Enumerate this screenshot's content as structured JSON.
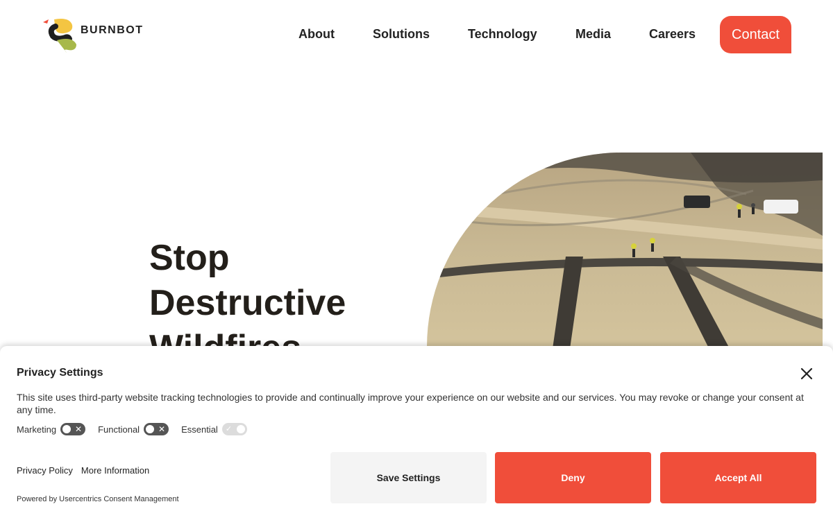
{
  "header": {
    "brand": "BURNBOT",
    "nav": [
      {
        "label": "About"
      },
      {
        "label": "Solutions"
      },
      {
        "label": "Technology"
      },
      {
        "label": "Media"
      },
      {
        "label": "Careers"
      }
    ],
    "contact_label": "Contact"
  },
  "hero": {
    "title_lines": [
      "Stop",
      "Destructive",
      "Wildfires"
    ]
  },
  "consent": {
    "title": "Privacy Settings",
    "description": "This site uses third-party website tracking technologies to provide and continually improve your experience on our website and our services. You may revoke or change your consent at any time.",
    "toggles": [
      {
        "label": "Marketing",
        "state": "off"
      },
      {
        "label": "Functional",
        "state": "off"
      },
      {
        "label": "Essential",
        "state": "on-disabled"
      }
    ],
    "links": [
      "Privacy Policy",
      "More Information"
    ],
    "powered_by": "Powered by Usercentrics Consent Management",
    "buttons": {
      "save": "Save Settings",
      "deny": "Deny",
      "accept": "Accept All"
    }
  },
  "colors": {
    "accent": "#f04e3a",
    "text_dark": "#231f1a"
  }
}
